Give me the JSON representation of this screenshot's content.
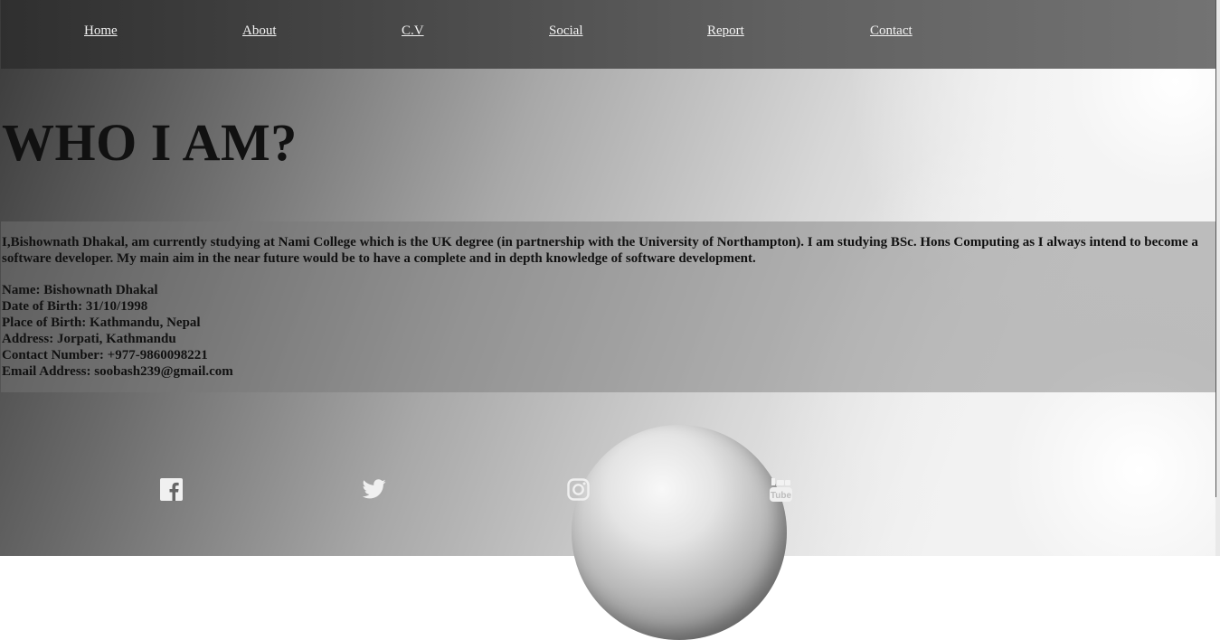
{
  "nav": {
    "items": [
      {
        "label": "Home"
      },
      {
        "label": "About"
      },
      {
        "label": "C.V"
      },
      {
        "label": "Social"
      },
      {
        "label": "Report"
      },
      {
        "label": "Contact"
      }
    ]
  },
  "main": {
    "title": "WHO I AM?",
    "intro": "I,Bishownath Dhakal, am currently studying at Nami College which is the UK degree (in partnership with the University of Northampton). I am studying BSc. Hons Computing as I always intend to become a software developer. My main aim in the near future would be to have a complete and in depth knowledge of software development.",
    "details": [
      "Name: Bishownath Dhakal",
      "Date of Birth: 31/10/1998",
      "Place of Birth: Kathmandu, Nepal",
      "Address: Jorpati, Kathmandu",
      "Contact Number: +977-9860098221",
      "Email Address: soobash239@gmail.com"
    ]
  },
  "social": {
    "icons": [
      "facebook-icon",
      "twitter-icon",
      "instagram-icon",
      "youtube-icon"
    ],
    "youtube_text": "You Tube"
  },
  "colors": {
    "nav_text": "#f2f2f2",
    "heading": "#111111"
  }
}
